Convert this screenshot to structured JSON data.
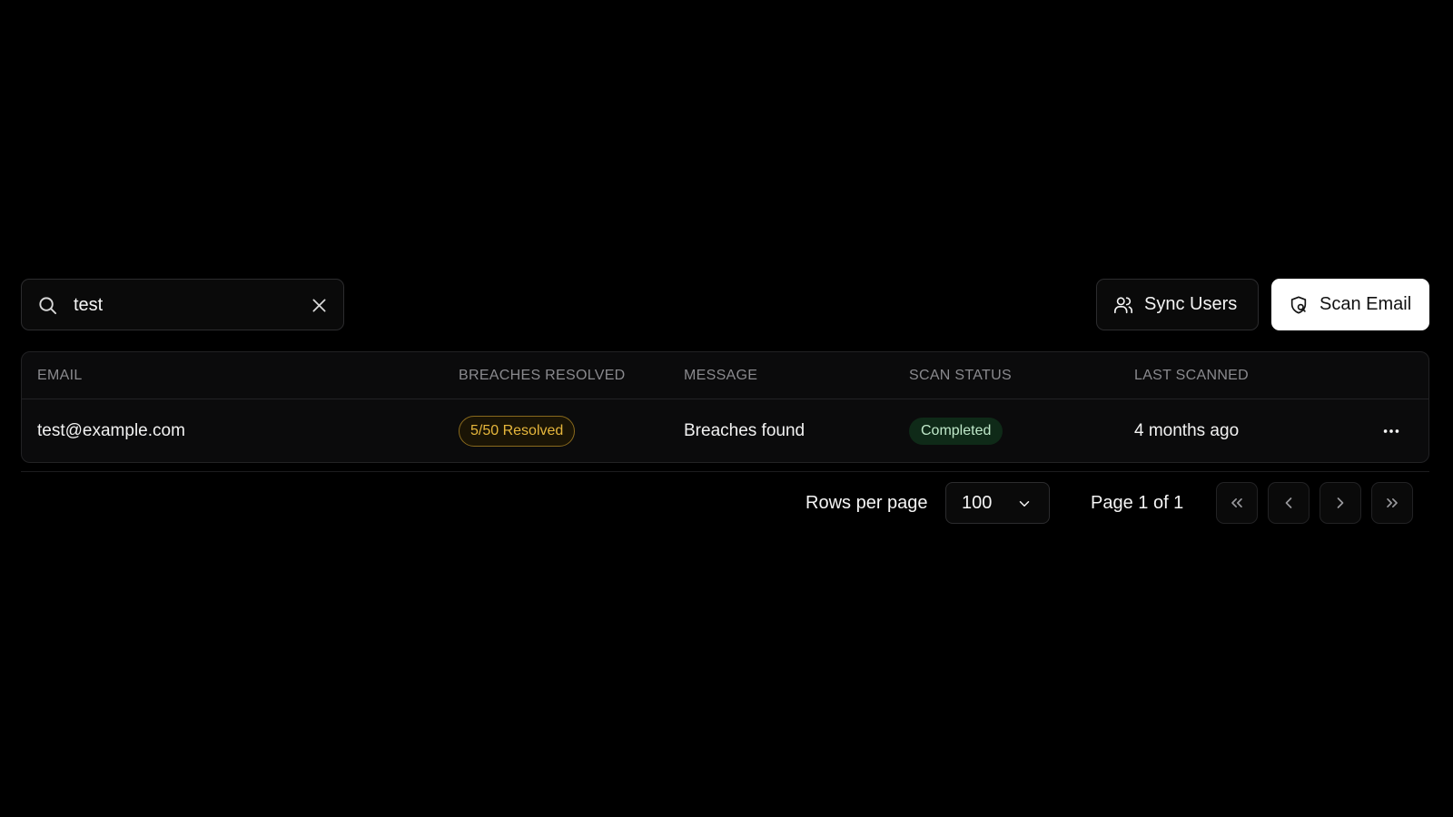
{
  "search": {
    "value": "test",
    "placeholder": ""
  },
  "toolbar": {
    "sync_label": "Sync Users",
    "scan_label": "Scan Email"
  },
  "table": {
    "headers": [
      "EMAIL",
      "BREACHES RESOLVED",
      "MESSAGE",
      "SCAN STATUS",
      "LAST SCANNED"
    ],
    "rows": [
      {
        "email": "test@example.com",
        "breaches_resolved": "5/50 Resolved",
        "message": "Breaches found",
        "scan_status": "Completed",
        "last_scanned": "4 months ago"
      }
    ]
  },
  "pagination": {
    "rows_label": "Rows per page",
    "rows_value": "100",
    "page_info": "Page 1 of 1"
  },
  "icons": {
    "search": "search-icon",
    "clear": "close-icon",
    "sync": "users-icon",
    "scan": "shield-search-icon",
    "more": "more-horizontal-icon",
    "select": "chevron-down-icon",
    "first": "chevrons-left-icon",
    "prev": "chevron-left-icon",
    "next": "chevron-right-icon",
    "last": "chevrons-right-icon"
  },
  "colors": {
    "background": "#000000",
    "surface": "#0b0b0c",
    "border": "#2c2c2e",
    "resolved_text": "#e7b73c",
    "resolved_border": "#8a6a1d",
    "status_bg": "#0f2a18",
    "status_text": "#bfe8c9",
    "primary_button": "#ffffff"
  }
}
